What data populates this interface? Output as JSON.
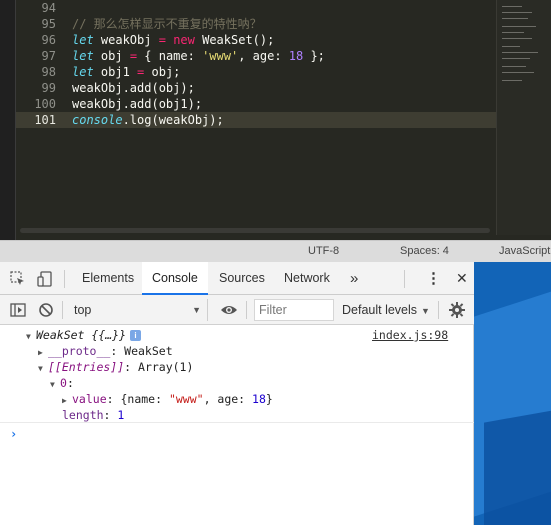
{
  "editor": {
    "line_numbers": [
      "94",
      "95",
      "96",
      "97",
      "98",
      "99",
      "100",
      "101"
    ],
    "active_line": "101",
    "code": {
      "l95_comment": "// 那么怎样显示不重复的特性呐？",
      "l96_kw": "let",
      "l96_a": " weakObj ",
      "l96_eq": "=",
      "l96_sp": " ",
      "l96_new": "new",
      "l96_b": " WeakSet();",
      "l97_kw": "let",
      "l97_a": " obj ",
      "l97_eq": "=",
      "l97_b": " { name: ",
      "l97_str": "'www'",
      "l97_c": ", age: ",
      "l97_num": "18",
      "l97_d": " };",
      "l98_kw": "let",
      "l98_a": " obj1 ",
      "l98_eq": "=",
      "l98_b": " obj;",
      "l99": "weakObj.add(obj);",
      "l100": "weakObj.add(obj1);",
      "l101_console": "console",
      "l101_rest": ".log(weakObj);"
    }
  },
  "statusbar": {
    "encoding": "UTF-8",
    "indent": "Spaces: 4",
    "language": "JavaScript"
  },
  "devtools": {
    "tabs": [
      "Elements",
      "Console",
      "Sources",
      "Network"
    ],
    "active_tab": "Console",
    "more_tabs_glyph": "»",
    "menu_glyph": "⋮",
    "close_glyph": "✕",
    "context": "top",
    "filter_placeholder": "Filter",
    "levels_label": "Default levels",
    "console": {
      "entry_label": "WeakSet {{…}}",
      "info_badge": "i",
      "source": "index.js:98",
      "proto_key": "__proto__",
      "proto_value": ": WeakSet",
      "entries_key": "[[Entries]]",
      "entries_value": ": Array(1)",
      "index_key": "0",
      "index_colon": ":",
      "value_key": "value",
      "value_prefix": ": {name: ",
      "value_name": "\"www\"",
      "value_mid": ", age: ",
      "value_age": "18",
      "value_suffix": "}",
      "length_key": "length",
      "length_colon": ": ",
      "length_value": "1",
      "prompt_glyph": "›"
    }
  },
  "colors": {
    "editor_bg": "#272822",
    "keyword": "#66d9ef",
    "operator": "#f92672",
    "string": "#e6db74",
    "number": "#ae81ff",
    "comment": "#75715e",
    "devtools_accent": "#1a73e8"
  }
}
